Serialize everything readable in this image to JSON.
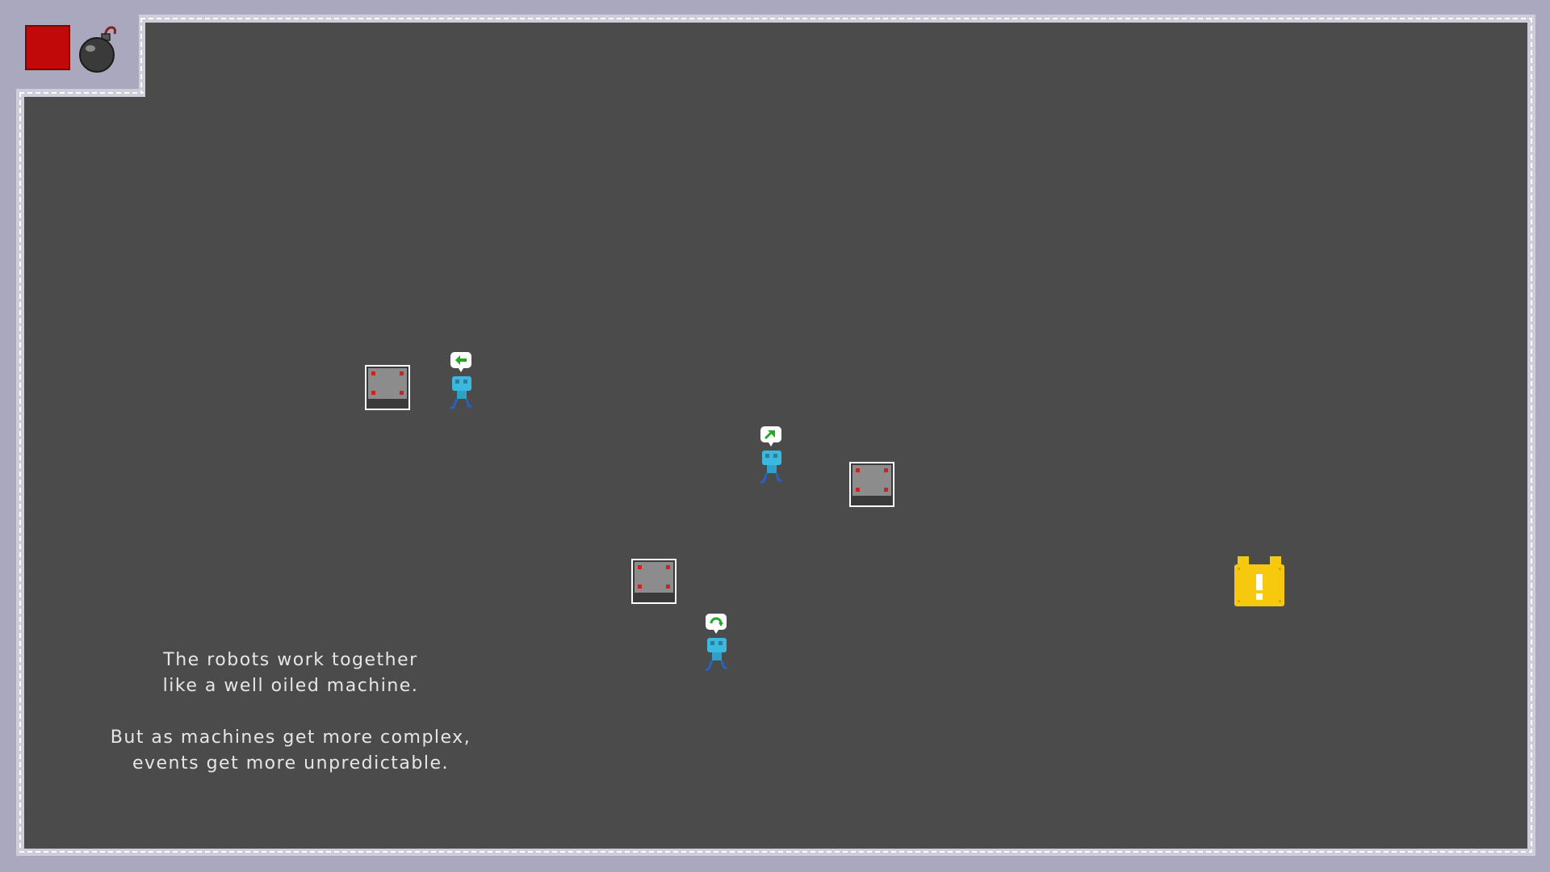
{
  "story": {
    "line1": "The robots work together",
    "line2": "like a well oiled machine.",
    "line3": "But as machines get more complex,",
    "line4": "events get more unpredictable."
  },
  "hud": {
    "stop_icon": "red-square-icon",
    "bomb_icon": "bomb-icon",
    "stop_color": "#c10909"
  },
  "robots": [
    {
      "id": "robot-1",
      "command": "move-left"
    },
    {
      "id": "robot-2",
      "command": "move-up-right"
    },
    {
      "id": "robot-3",
      "command": "rotate"
    }
  ],
  "crates": [
    {
      "id": "crate-1"
    },
    {
      "id": "crate-2"
    },
    {
      "id": "crate-3"
    }
  ],
  "goal": {
    "icon": "exclamation-lock-icon",
    "color": "#f6c90e"
  },
  "colors": {
    "background": "#aaa8bf",
    "floor": "#4b4b4b",
    "robot_body": "#3bb8e0",
    "command_arrow": "#22aa22"
  }
}
